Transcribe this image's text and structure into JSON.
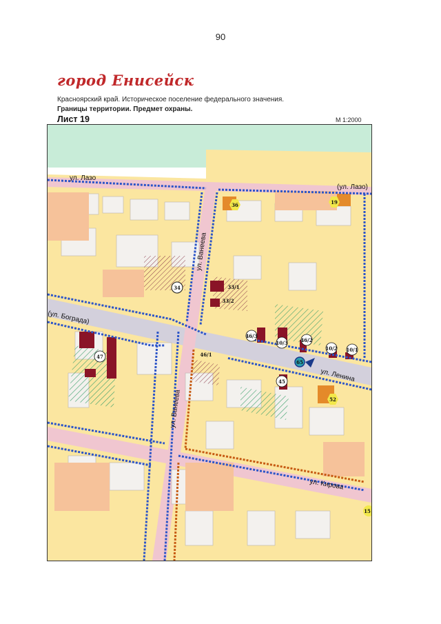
{
  "page_number": "90",
  "title": "город Енисейск",
  "subtitle": "Красноярский край. Историческое поселение федерального значения.",
  "subtitle_bold": "Границы территории. Предмет охраны.",
  "sheet": "Лист 19",
  "scale": "М 1:2000",
  "streets": {
    "lazo": "ул. Лазо",
    "lazo_right": "(ул. Лазо)",
    "vaneeva_top": "ул. Ванеева",
    "vaneeva_bottom": "ул. Ванеева",
    "bograda": "(ул. Бограда)",
    "lenina": "ул. Ленина",
    "kirova": "ул. Кирова"
  },
  "markers": {
    "m36": "36",
    "m19": "19",
    "m34": "34",
    "m33_1": "33/1",
    "m33_2": "33/2",
    "m46_3": "46/3",
    "m10_3": "10/3",
    "m46_2": "46/2",
    "m10_2": "10/2",
    "m10_1": "10/1",
    "m47": "47",
    "m46_1": "46/1",
    "m45": "45",
    "m52": "52",
    "m15": "15",
    "m65": "65"
  },
  "colors": {
    "title": "#c0282a",
    "land": "#fbe6a0",
    "road": "#f0c6d0",
    "building": "#f0f0f0",
    "monument": "#8a1427",
    "boundary_blue": "#2b54c8",
    "boundary_orange": "#c65a12",
    "river": "#c8ecd8"
  }
}
